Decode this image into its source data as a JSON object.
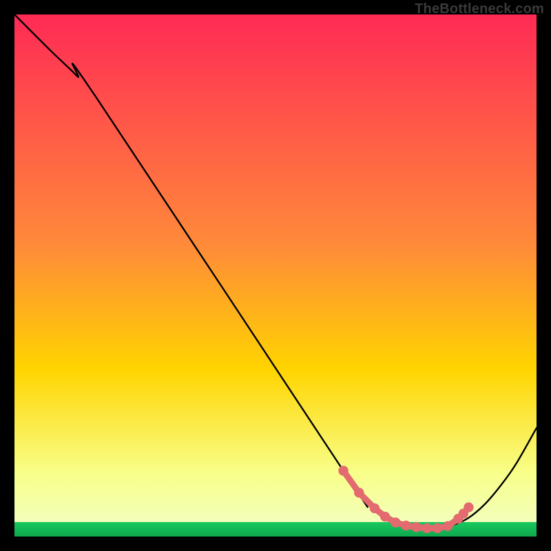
{
  "watermark": "TheBottleneck.com",
  "chart_data": {
    "type": "line",
    "title": "",
    "xlabel": "",
    "ylabel": "",
    "xlim": [
      0,
      100
    ],
    "ylim": [
      0,
      100
    ],
    "grid": false,
    "gradient_bg": {
      "top": "#ff2a55",
      "middle": "#ffd400",
      "bottom_band": "#f8ff8a",
      "bottom_edge": "#18c95e"
    },
    "series": [
      {
        "name": "curve",
        "stroke": "#000000",
        "points_xy": [
          [
            0,
            100
          ],
          [
            7,
            93
          ],
          [
            12,
            88.2
          ],
          [
            16,
            83.6
          ],
          [
            63,
            12.6
          ],
          [
            66,
            8.4
          ],
          [
            69,
            5.4
          ],
          [
            72,
            3.3
          ],
          [
            75,
            2.1
          ],
          [
            78,
            1.6
          ],
          [
            81,
            1.6
          ],
          [
            84,
            2.2
          ],
          [
            87,
            3.6
          ],
          [
            90,
            6.1
          ],
          [
            93,
            9.6
          ],
          [
            96,
            13.8
          ],
          [
            100,
            20.8
          ]
        ]
      },
      {
        "name": "valley-dots",
        "stroke": "#e36a6f",
        "fill": "#e36a6f",
        "points_xy": [
          [
            63,
            12.6
          ],
          [
            66,
            8.4
          ],
          [
            69,
            5.4
          ],
          [
            71,
            3.8
          ],
          [
            73,
            2.7
          ],
          [
            75,
            2.1
          ],
          [
            77,
            1.8
          ],
          [
            79,
            1.6
          ],
          [
            81,
            1.6
          ],
          [
            83,
            2.0
          ],
          [
            85,
            3.4
          ],
          [
            86,
            4.4
          ],
          [
            87,
            5.6
          ]
        ]
      }
    ]
  }
}
